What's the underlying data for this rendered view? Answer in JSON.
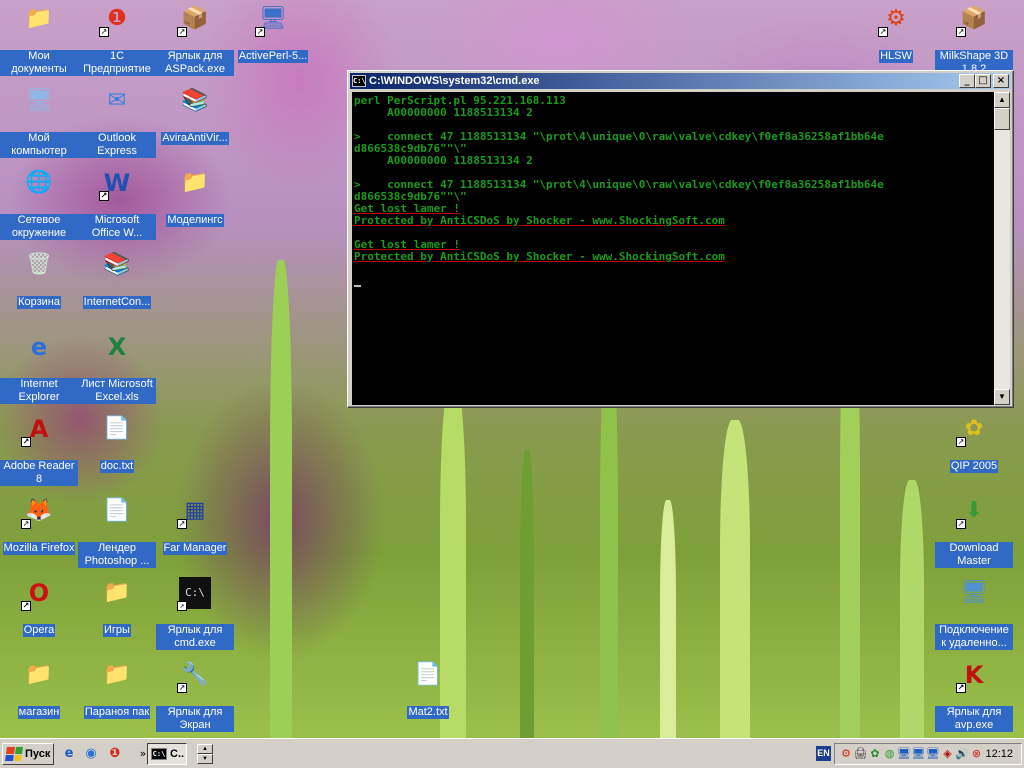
{
  "desktop": {
    "icons": [
      {
        "id": "my-documents",
        "label": "Мои документы",
        "glyph": "📁",
        "icon": "folder-documents-icon"
      },
      {
        "id": "1c",
        "label": "1С Предприятие",
        "glyph": "❶",
        "icon": "1c-app-icon",
        "shortcut": true
      },
      {
        "id": "aspack",
        "label": "Ярлык для ASPack.exe",
        "glyph": "📦",
        "icon": "aspack-icon",
        "shortcut": true
      },
      {
        "id": "activeperl",
        "label": "ActivePerl-5...",
        "glyph": "🖥",
        "icon": "activeperl-installer-icon",
        "shortcut": true
      },
      {
        "id": "my-computer",
        "label": "Мой компьютер",
        "glyph": "🖥",
        "icon": "my-computer-icon"
      },
      {
        "id": "outlook",
        "label": "Outlook Express",
        "glyph": "✉",
        "icon": "outlook-express-icon"
      },
      {
        "id": "avira",
        "label": "AviraAntiVir...",
        "glyph": "📚",
        "icon": "winrar-archive-icon"
      },
      {
        "id": "network",
        "label": "Сетевое окружение",
        "glyph": "🌐",
        "icon": "network-places-icon"
      },
      {
        "id": "word",
        "label": "Microsoft Office W...",
        "glyph": "W",
        "icon": "word-document-icon",
        "shortcut": true
      },
      {
        "id": "modelings",
        "label": "Моделингс",
        "glyph": "📁",
        "icon": "folder-icon"
      },
      {
        "id": "recycle",
        "label": "Корзина",
        "glyph": "🗑",
        "icon": "recycle-bin-icon"
      },
      {
        "id": "internetcon",
        "label": "InternetCon...",
        "glyph": "📚",
        "icon": "winrar-archive-icon"
      },
      {
        "id": "ie",
        "label": "Internet Explorer",
        "glyph": "e",
        "icon": "internet-explorer-icon"
      },
      {
        "id": "excel",
        "label": "Лист Microsoft Excel.xls",
        "glyph": "X",
        "icon": "excel-spreadsheet-icon"
      },
      {
        "id": "adobe",
        "label": "Adobe Reader 8",
        "glyph": "A",
        "icon": "adobe-reader-icon",
        "shortcut": true
      },
      {
        "id": "doctxt",
        "label": "doc.txt",
        "glyph": "📄",
        "icon": "text-file-icon"
      },
      {
        "id": "firefox",
        "label": "Mozilla Firefox",
        "glyph": "🦊",
        "icon": "firefox-icon",
        "shortcut": true
      },
      {
        "id": "lender",
        "label": "Лендер Photoshop ...",
        "glyph": "📄",
        "icon": "text-file-icon"
      },
      {
        "id": "far",
        "label": "Far Manager",
        "glyph": "▦",
        "icon": "far-manager-icon",
        "shortcut": true
      },
      {
        "id": "opera",
        "label": "Opera",
        "glyph": "O",
        "icon": "opera-icon",
        "shortcut": true
      },
      {
        "id": "games",
        "label": "Игры",
        "glyph": "📁",
        "icon": "folder-icon"
      },
      {
        "id": "cmdlink",
        "label": "Ярлык для cmd.exe",
        "glyph": "C:\\",
        "icon": "cmd-shortcut-icon",
        "shortcut": true
      },
      {
        "id": "magazin",
        "label": "магазин",
        "glyph": "📁",
        "icon": "folder-icon"
      },
      {
        "id": "paranoia",
        "label": "Параноя пак",
        "glyph": "📁",
        "icon": "folder-icon"
      },
      {
        "id": "ekran",
        "label": "Ярлык для Экран",
        "glyph": "🔧",
        "icon": "screen-settings-icon",
        "shortcut": true
      },
      {
        "id": "mat2",
        "label": "Mat2.txt",
        "glyph": "📄",
        "icon": "text-file-icon"
      },
      {
        "id": "hlsw",
        "label": "HLSW",
        "glyph": "⚙",
        "icon": "hlsw-icon",
        "shortcut": true
      },
      {
        "id": "milkshape",
        "label": "MilkShape 3D 1.8.2",
        "glyph": "📦",
        "icon": "milkshape-icon",
        "shortcut": true
      },
      {
        "id": "qip",
        "label": "QIP 2005",
        "glyph": "✿",
        "icon": "qip-icon",
        "shortcut": true
      },
      {
        "id": "dlmaster",
        "label": "Download Master",
        "glyph": "⬇",
        "icon": "download-master-icon",
        "shortcut": true
      },
      {
        "id": "remote",
        "label": "Подключение к удаленно...",
        "glyph": "🖥",
        "icon": "remote-desktop-icon"
      },
      {
        "id": "avp",
        "label": "Ярлык для avp.exe",
        "glyph": "K",
        "icon": "kaspersky-icon",
        "shortcut": true
      }
    ]
  },
  "cmd": {
    "title": "C:\\WINDOWS\\system32\\cmd.exe",
    "icon_text": "C:\\",
    "lines": [
      {
        "text": "perl PerScript.pl 95.221.168.113",
        "red": false
      },
      {
        "text": "     A00000000 1188513134 2",
        "red": false
      },
      {
        "text": "",
        "red": false
      },
      {
        "text": ">    connect 47 1188513134 \"\\prot\\4\\unique\\0\\raw\\valve\\cdkey\\f0ef8a36258af1bb64e",
        "red": false
      },
      {
        "text": "d866538c9db76\"\"\\\"",
        "red": false
      },
      {
        "text": "     A00000000 1188513134 2",
        "red": false
      },
      {
        "text": "",
        "red": false
      },
      {
        "text": ">    connect 47 1188513134 \"\\prot\\4\\unique\\0\\raw\\valve\\cdkey\\f0ef8a36258af1bb64e",
        "red": false
      },
      {
        "text": "d866538c9db76\"\"\\\"",
        "red": false
      },
      {
        "text": "Get lost lamer !",
        "red": true
      },
      {
        "text": "Protected by AntiCSDoS by Shocker - www.ShockingSoft.com",
        "red": true
      },
      {
        "text": "",
        "red": false
      },
      {
        "text": "Get lost lamer !",
        "red": true
      },
      {
        "text": "Protected by AntiCSDoS by Shocker - www.ShockingSoft.com",
        "red": true
      }
    ],
    "buttons": {
      "minimize": "_",
      "maximize": "□",
      "close": "×"
    }
  },
  "taskbar": {
    "start_label": "Пуск",
    "task_label": "C..",
    "task_icon_text": "C:\\",
    "language": "EN",
    "clock": "12:12",
    "quicklaunch": [
      {
        "glyph": "e",
        "icon": "ie-quicklaunch-icon",
        "color": "#1d5cc7"
      },
      {
        "glyph": "◉",
        "icon": "show-desktop-icon",
        "color": "#2a6fd4"
      },
      {
        "glyph": "❶",
        "icon": "1c-quicklaunch-icon",
        "color": "#d03020"
      }
    ],
    "more": "»",
    "tray": [
      {
        "glyph": "⚙",
        "icon": "hlsw-tray-icon",
        "color": "#d03010"
      },
      {
        "glyph": "🖨",
        "icon": "printer-tray-icon",
        "color": "#404040"
      },
      {
        "glyph": "✿",
        "icon": "qip-tray-icon",
        "color": "#2c8a2c"
      },
      {
        "glyph": "◍",
        "icon": "antivirus-tray-icon",
        "color": "#2c9a2c"
      },
      {
        "glyph": "🖥",
        "icon": "network-tray-icon",
        "color": "#2060c0"
      },
      {
        "glyph": "🖥",
        "icon": "network2-tray-icon",
        "color": "#2060c0"
      },
      {
        "glyph": "🖥",
        "icon": "network3-tray-icon",
        "color": "#2060c0"
      },
      {
        "glyph": "◈",
        "icon": "kaspersky-tray-icon",
        "color": "#b01010"
      },
      {
        "glyph": "🔊",
        "icon": "volume-tray-icon",
        "color": "#404040"
      },
      {
        "glyph": "⊗",
        "icon": "disconnect-tray-icon",
        "color": "#d02020"
      }
    ]
  }
}
